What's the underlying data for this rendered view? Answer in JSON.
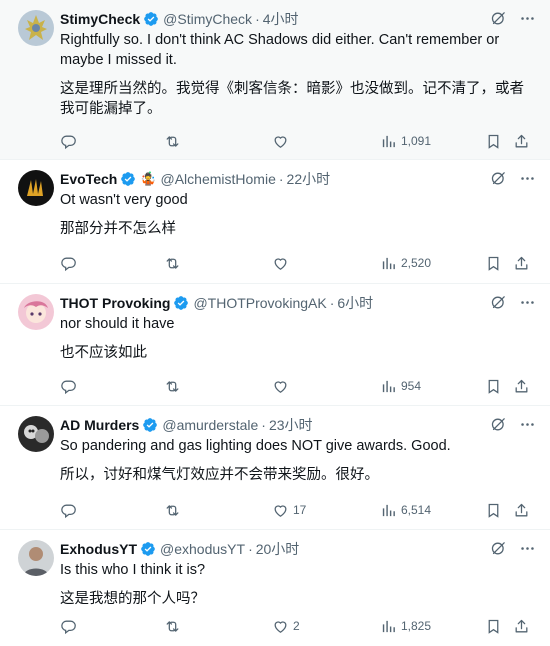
{
  "colors": {
    "verified": "#1d9bf0",
    "text": "#0f1419",
    "secondary": "#536471",
    "border": "#eff3f4",
    "highlight_bg": "#f7f9f9"
  },
  "icons": {
    "reply": "reply-icon",
    "repost": "repost-icon",
    "like": "like-icon",
    "views": "views-icon",
    "bookmark": "bookmark-icon",
    "share": "share-icon",
    "grok": "grok-icon",
    "more": "more-icon"
  },
  "tweets": [
    {
      "name": "StimyCheck",
      "handle": "@StimyCheck",
      "time": "4小时",
      "text": "Rightfully so. I don't think AC Shadows did either. Can't remember or maybe I missed it.",
      "translation": "这是理所当然的。我觉得《刺客信条：暗影》也没做到。记不清了，或者我可能漏掉了。",
      "replies": "",
      "reposts": "",
      "likes": "",
      "views": "1,091"
    },
    {
      "name": "EvoTech",
      "emoji": "🤹",
      "handle": "@AlchemistHomie",
      "time": "22小时",
      "text": "Ot wasn't very good",
      "translation": "那部分并不怎么样",
      "replies": "",
      "reposts": "",
      "likes": "",
      "views": "2,520"
    },
    {
      "name": "THOT Provoking",
      "handle": "@THOTProvokingAK",
      "time": "6小时",
      "text": "nor should it have",
      "translation": "也不应该如此",
      "replies": "",
      "reposts": "",
      "likes": "",
      "views": "954"
    },
    {
      "name": "AD Murders",
      "handle": "@amurderstale",
      "time": "23小时",
      "text": "So pandering and gas lighting does NOT give awards. Good.",
      "translation": "所以，讨好和煤气灯效应并不会带来奖励。很好。",
      "replies": "",
      "reposts": "",
      "likes": "17",
      "views": "6,514"
    },
    {
      "name": "ExhodusYT",
      "handle": "@exhodusYT",
      "time": "20小时",
      "text": "Is this who I think it is?",
      "translation": "这是我想的那个人吗？",
      "replies": "",
      "reposts": "",
      "likes": "2",
      "views": "1,825"
    }
  ]
}
